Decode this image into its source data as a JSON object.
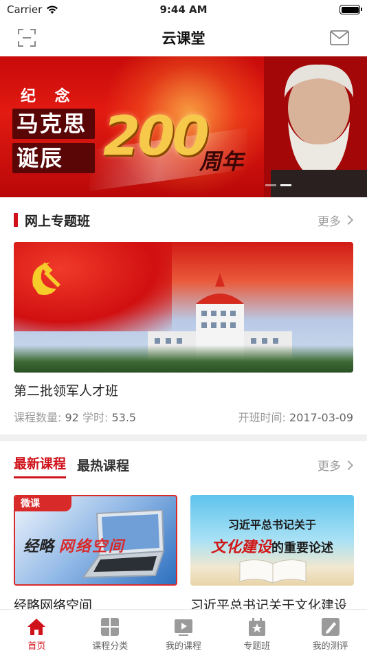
{
  "status_bar": {
    "carrier": "Carrier",
    "time": "9:44 AM"
  },
  "nav": {
    "title": "云课堂"
  },
  "banner": {
    "kicker": "纪 念",
    "line1": "马克思",
    "line2": "诞辰",
    "number": "200",
    "suffix": "周年"
  },
  "section_online": {
    "title": "网上专题班",
    "more": "更多"
  },
  "featured": {
    "title": "第二批领军人才班",
    "course_count_label": "课程数量:",
    "course_count": "92",
    "hours_label": "学时:",
    "hours": "53.5",
    "start_label": "开班时间:",
    "start_date": "2017-03-09"
  },
  "courses_section": {
    "tabs": [
      "最新课程",
      "最热课程"
    ],
    "more": "更多"
  },
  "courses": [
    {
      "badge": "微课",
      "img_text_a": "经略",
      "img_text_b": "网络空间",
      "title": "经略网络空间"
    },
    {
      "img_line1": "习近平总书记关于",
      "img_line2_a": "文化建设",
      "img_line2_b": "的重要论述",
      "title": "习近平总书记关于文化建设"
    }
  ],
  "tab_bar": {
    "items": [
      {
        "label": "首页",
        "icon": "home-icon",
        "active": true
      },
      {
        "label": "课程分类",
        "icon": "grid-icon",
        "active": false
      },
      {
        "label": "我的课程",
        "icon": "play-icon",
        "active": false
      },
      {
        "label": "专题班",
        "icon": "star-board-icon",
        "active": false
      },
      {
        "label": "我的测评",
        "icon": "pen-icon",
        "active": false
      }
    ]
  },
  "colors": {
    "accent": "#d0121b",
    "muted": "#999999"
  }
}
